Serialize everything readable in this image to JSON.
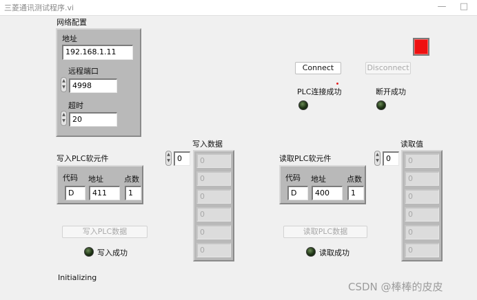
{
  "window": {
    "title": "三菱通讯测试程序.vi",
    "minimize_glyph": "—",
    "close_glyph": "□"
  },
  "network": {
    "section_label": "网络配置",
    "address_label": "地址",
    "address_value": "192.168.1.11",
    "port_label": "远程端口",
    "port_value": "4998",
    "timeout_label": "超时",
    "timeout_value": "20"
  },
  "connection": {
    "connect_label": "Connect",
    "disconnect_label": "Disconnect",
    "connected_led_label": "PLC连接成功",
    "disconnected_led_label": "断开成功"
  },
  "write": {
    "device_label": "写入PLC软元件",
    "code_label": "代码",
    "address_label": "地址",
    "count_label": "点数",
    "code_value": "D",
    "address_value": "411",
    "count_value": "1",
    "data_label": "写入数据",
    "index_value": "0",
    "data_values": [
      "0",
      "0",
      "0",
      "0",
      "0",
      "0"
    ],
    "button_label": "写入PLC数据",
    "success_label": "写入成功"
  },
  "read": {
    "device_label": "读取PLC软元件",
    "code_label": "代码",
    "address_label": "地址",
    "count_label": "点数",
    "code_value": "D",
    "address_value": "400",
    "count_value": "1",
    "data_label": "读取值",
    "index_value": "0",
    "data_values": [
      "0",
      "0",
      "0",
      "0",
      "0",
      "0"
    ],
    "button_label": "读取PLC数据",
    "success_label": "读取成功"
  },
  "status": {
    "text": "Initializing"
  },
  "watermark": "CSDN @棒棒的皮皮",
  "colors": {
    "stop_button": "#ee1010",
    "led_off": "#1e3315",
    "frame_gray": "#b9b9b9"
  }
}
